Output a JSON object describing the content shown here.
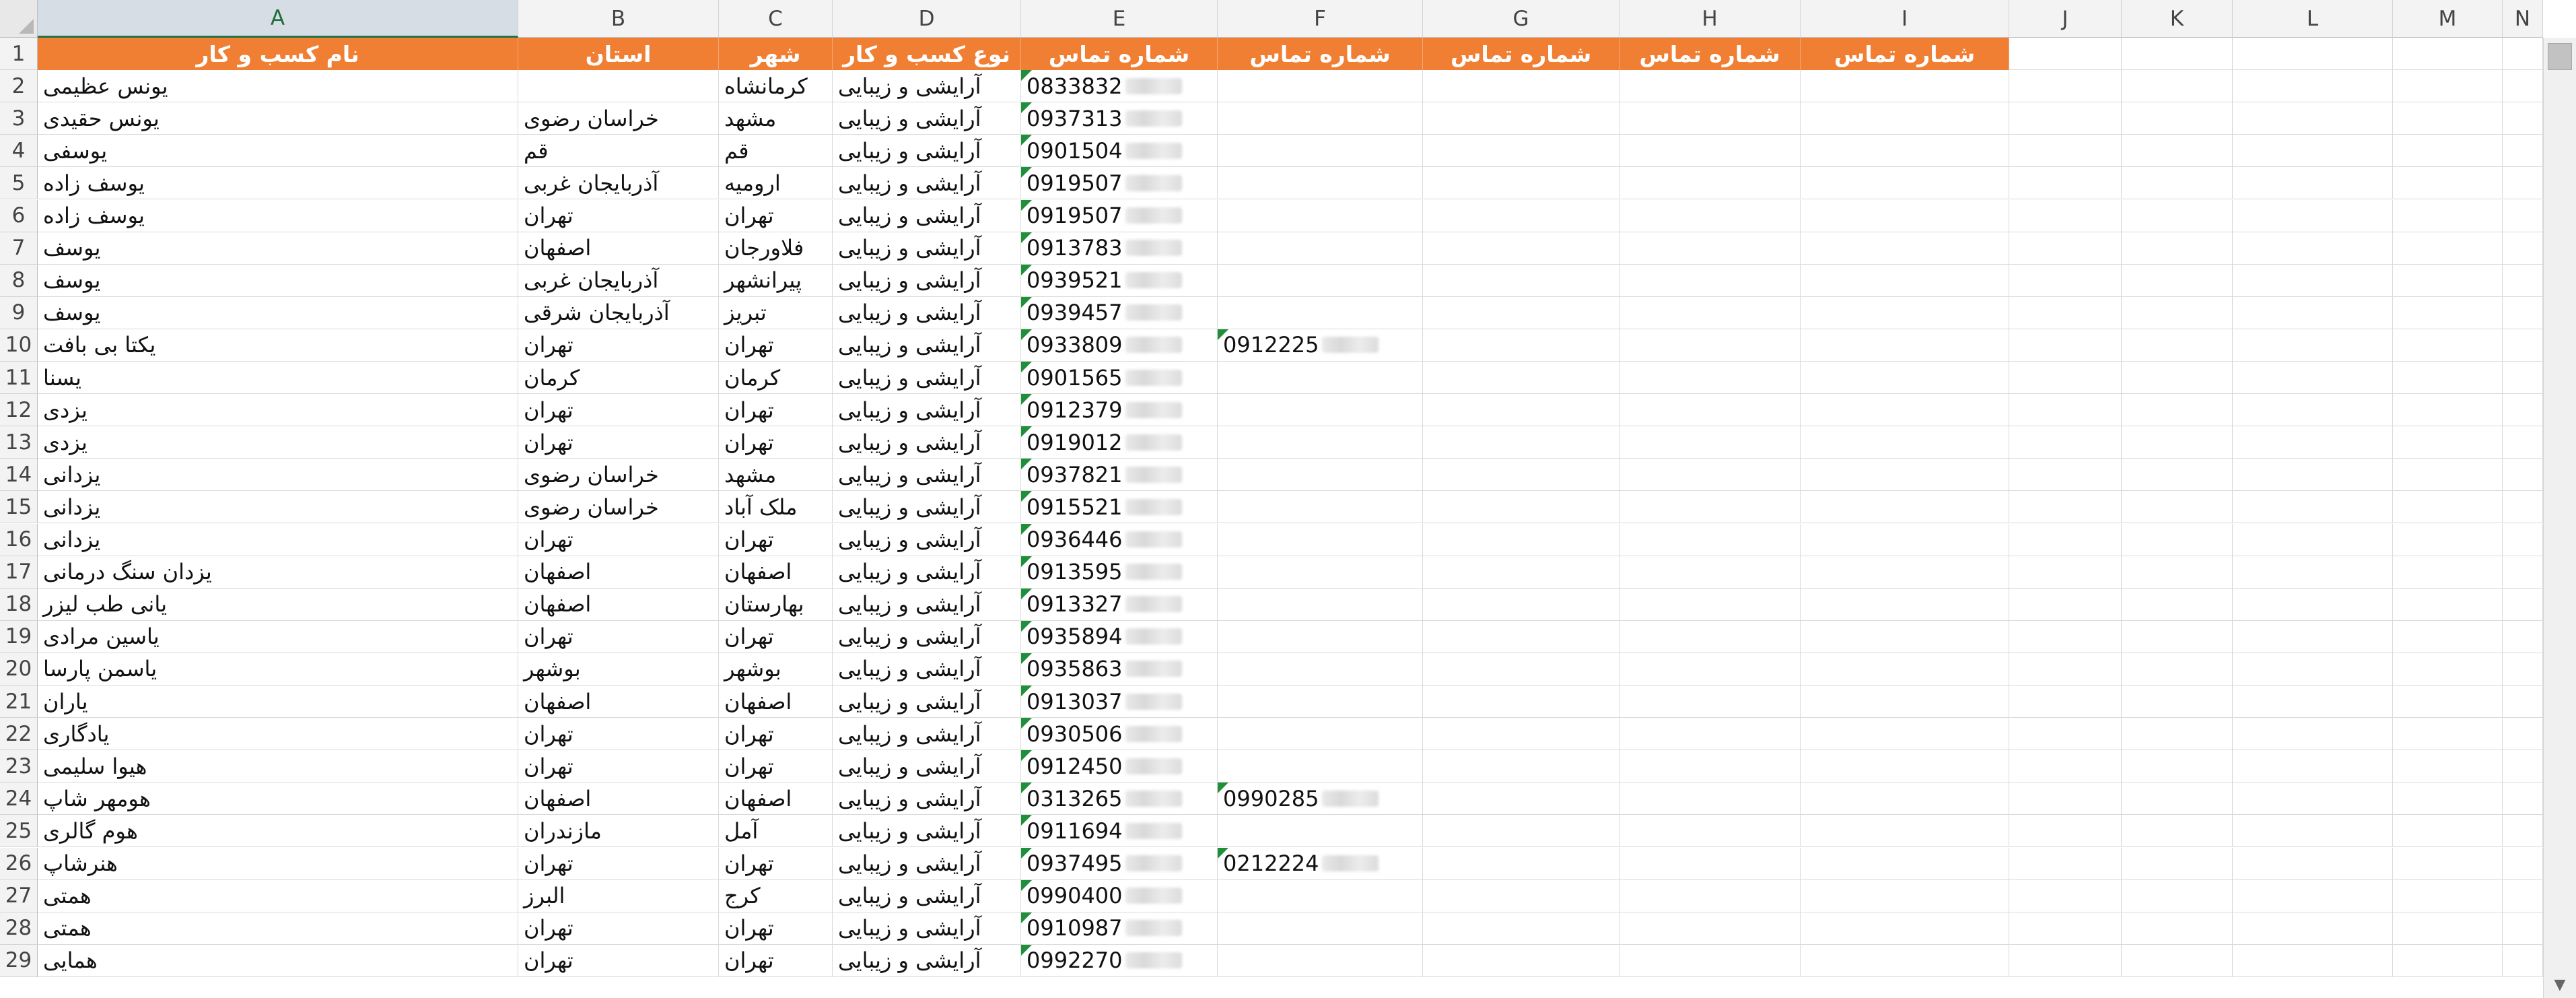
{
  "columns": [
    "A",
    "B",
    "C",
    "D",
    "E",
    "F",
    "G",
    "H",
    "I",
    "J",
    "K",
    "L",
    "M",
    "N"
  ],
  "active_column": "A",
  "header_row": {
    "row_number": "1",
    "name": "نام کسب و کار",
    "province": "استان",
    "city": "شهر",
    "business_type": "نوع کسب و کار",
    "phone": "شماره تماس"
  },
  "rows": [
    {
      "n": "2",
      "name": "یونس عظیمی",
      "province": "",
      "city": "کرمانشاه",
      "type": "آرایشی و زیبایی",
      "phone": "0833832",
      "phone2": ""
    },
    {
      "n": "3",
      "name": "یونس حقیدی",
      "province": "خراسان رضوی",
      "city": "مشهد",
      "type": "آرایشی و زیبایی",
      "phone": "0937313",
      "phone2": ""
    },
    {
      "n": "4",
      "name": "یوسفی",
      "province": "قم",
      "city": "قم",
      "type": "آرایشی و زیبایی",
      "phone": "0901504",
      "phone2": ""
    },
    {
      "n": "5",
      "name": "یوسف زاده",
      "province": "آذربایجان غربی",
      "city": "ارومیه",
      "type": "آرایشی و زیبایی",
      "phone": "0919507",
      "phone2": ""
    },
    {
      "n": "6",
      "name": "یوسف زاده",
      "province": "تهران",
      "city": "تهران",
      "type": "آرایشی و زیبایی",
      "phone": "0919507",
      "phone2": ""
    },
    {
      "n": "7",
      "name": "یوسف",
      "province": "اصفهان",
      "city": "فلاورجان",
      "type": "آرایشی و زیبایی",
      "phone": "0913783",
      "phone2": ""
    },
    {
      "n": "8",
      "name": "یوسف",
      "province": "آذربایجان غربی",
      "city": "پیرانشهر",
      "type": "آرایشی و زیبایی",
      "phone": "0939521",
      "phone2": ""
    },
    {
      "n": "9",
      "name": "یوسف",
      "province": "آذربایجان شرقی",
      "city": "تبریز",
      "type": "آرایشی و زیبایی",
      "phone": "0939457",
      "phone2": ""
    },
    {
      "n": "10",
      "name": "یکتا بی بافت",
      "province": "تهران",
      "city": "تهران",
      "type": "آرایشی و زیبایی",
      "phone": "0933809",
      "phone2": "0912225"
    },
    {
      "n": "11",
      "name": "یسنا",
      "province": "کرمان",
      "city": "کرمان",
      "type": "آرایشی و زیبایی",
      "phone": "0901565",
      "phone2": ""
    },
    {
      "n": "12",
      "name": "یزدی",
      "province": "تهران",
      "city": "تهران",
      "type": "آرایشی و زیبایی",
      "phone": "0912379",
      "phone2": ""
    },
    {
      "n": "13",
      "name": "یزدی",
      "province": "تهران",
      "city": "تهران",
      "type": "آرایشی و زیبایی",
      "phone": "0919012",
      "phone2": ""
    },
    {
      "n": "14",
      "name": "یزدانی",
      "province": "خراسان رضوی",
      "city": "مشهد",
      "type": "آرایشی و زیبایی",
      "phone": "0937821",
      "phone2": ""
    },
    {
      "n": "15",
      "name": "یزدانی",
      "province": "خراسان رضوی",
      "city": "ملک آباد",
      "type": "آرایشی و زیبایی",
      "phone": "0915521",
      "phone2": ""
    },
    {
      "n": "16",
      "name": "یزدانی",
      "province": "تهران",
      "city": "تهران",
      "type": "آرایشی و زیبایی",
      "phone": "0936446",
      "phone2": ""
    },
    {
      "n": "17",
      "name": "یزدان سنگ درمانی",
      "province": "اصفهان",
      "city": "اصفهان",
      "type": "آرایشی و زیبایی",
      "phone": "0913595",
      "phone2": ""
    },
    {
      "n": "18",
      "name": "یانی طب لیزر",
      "province": "اصفهان",
      "city": "بهارستان",
      "type": "آرایشی و زیبایی",
      "phone": "0913327",
      "phone2": ""
    },
    {
      "n": "19",
      "name": "یاسین مرادی",
      "province": "تهران",
      "city": "تهران",
      "type": "آرایشی و زیبایی",
      "phone": "0935894",
      "phone2": ""
    },
    {
      "n": "20",
      "name": "یاسمن پارسا",
      "province": "بوشهر",
      "city": "بوشهر",
      "type": "آرایشی و زیبایی",
      "phone": "0935863",
      "phone2": ""
    },
    {
      "n": "21",
      "name": "یاران",
      "province": "اصفهان",
      "city": "اصفهان",
      "type": "آرایشی و زیبایی",
      "phone": "0913037",
      "phone2": ""
    },
    {
      "n": "22",
      "name": "یادگاری",
      "province": "تهران",
      "city": "تهران",
      "type": "آرایشی و زیبایی",
      "phone": "0930506",
      "phone2": ""
    },
    {
      "n": "23",
      "name": "هیوا سلیمی",
      "province": "تهران",
      "city": "تهران",
      "type": "آرایشی و زیبایی",
      "phone": "0912450",
      "phone2": ""
    },
    {
      "n": "24",
      "name": "هومهر شاپ",
      "province": "اصفهان",
      "city": "اصفهان",
      "type": "آرایشی و زیبایی",
      "phone": "0313265",
      "phone2": "0990285"
    },
    {
      "n": "25",
      "name": "هوم گالری",
      "province": "مازندران",
      "city": "آمل",
      "type": "آرایشی و زیبایی",
      "phone": "0911694",
      "phone2": ""
    },
    {
      "n": "26",
      "name": "هنرشاپ",
      "province": "تهران",
      "city": "تهران",
      "type": "آرایشی و زیبایی",
      "phone": "0937495",
      "phone2": "0212224"
    },
    {
      "n": "27",
      "name": "همتی",
      "province": "البرز",
      "city": "کرج",
      "type": "آرایشی و زیبایی",
      "phone": "0990400",
      "phone2": ""
    },
    {
      "n": "28",
      "name": "همتی",
      "province": "تهران",
      "city": "تهران",
      "type": "آرایشی و زیبایی",
      "phone": "0910987",
      "phone2": ""
    },
    {
      "n": "29",
      "name": "همایی",
      "province": "تهران",
      "city": "تهران",
      "type": "آرایشی و زیبایی",
      "phone": "0992270",
      "phone2": ""
    }
  ],
  "colors": {
    "header_fill": "#f07f34",
    "header_text": "#ffffff",
    "active_column_accent": "#217346",
    "comment_marker": "#1f8f3a"
  },
  "icons": {
    "select_all": "select-all-triangle-icon",
    "scroll_up": "arrow-up-icon",
    "scroll_down": "arrow-down-icon"
  }
}
